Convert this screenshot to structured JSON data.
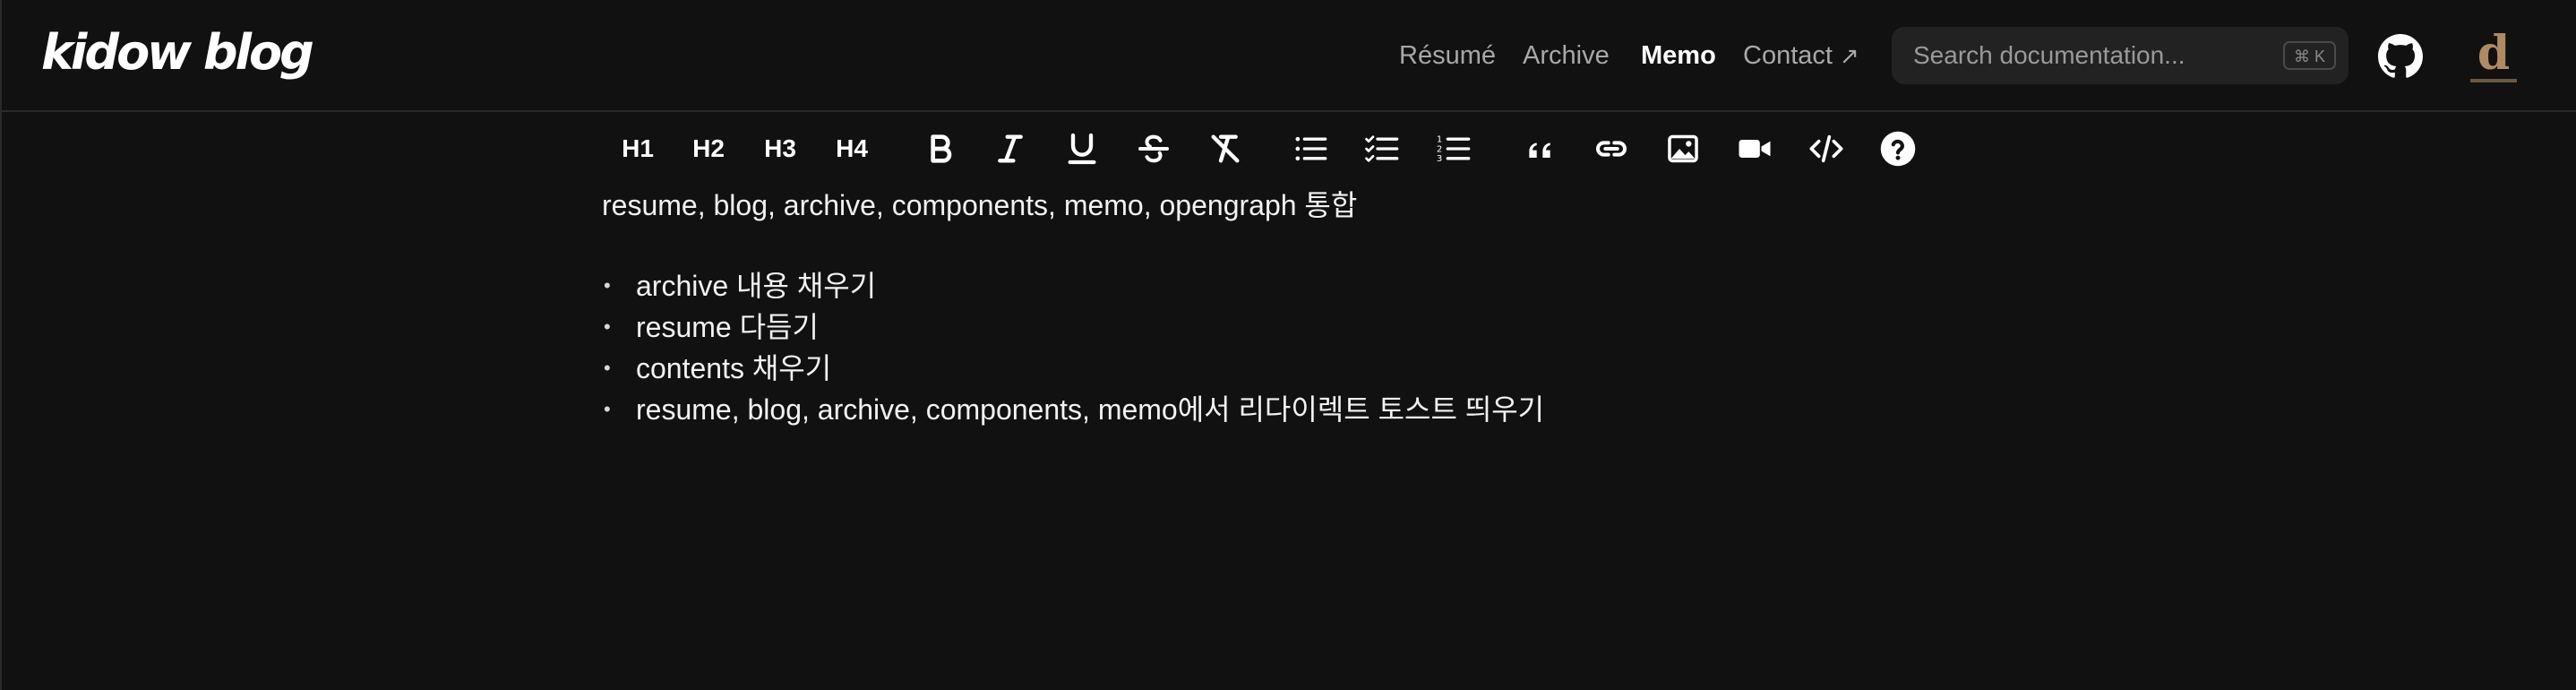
{
  "site": {
    "logo": "kidow blog"
  },
  "nav": {
    "resume": "Résumé",
    "archive": "Archive",
    "memo": "Memo",
    "contact": "Contact",
    "contact_icon": "↗",
    "active": "memo"
  },
  "search": {
    "placeholder": "Search documentation...",
    "shortcut": "⌘ K"
  },
  "header_icons": {
    "github": "github-icon",
    "avatar_letter": "d"
  },
  "toolbar": {
    "h1": "H1",
    "h2": "H2",
    "h3": "H3",
    "h4": "H4",
    "icons": [
      "bold-icon",
      "italic-icon",
      "underline-icon",
      "strikethrough-icon",
      "clear-format-icon",
      "bullet-list-icon",
      "checklist-icon",
      "numbered-list-icon",
      "quote-icon",
      "link-icon",
      "image-icon",
      "video-icon",
      "code-icon",
      "help-icon"
    ]
  },
  "editor": {
    "paragraph": "resume, blog, archive, components, memo, opengraph 통합",
    "items": [
      "archive 내용 채우기",
      "resume 다듬기",
      "contents 채우기",
      "resume, blog, archive, components, memo에서 리다이렉트 토스트 띄우기"
    ]
  },
  "colors": {
    "background": "#111111",
    "text": "#f2f2f2",
    "nav_inactive": "#a8a8a8",
    "search_bg": "#222222",
    "avatar": "#b08a63"
  }
}
